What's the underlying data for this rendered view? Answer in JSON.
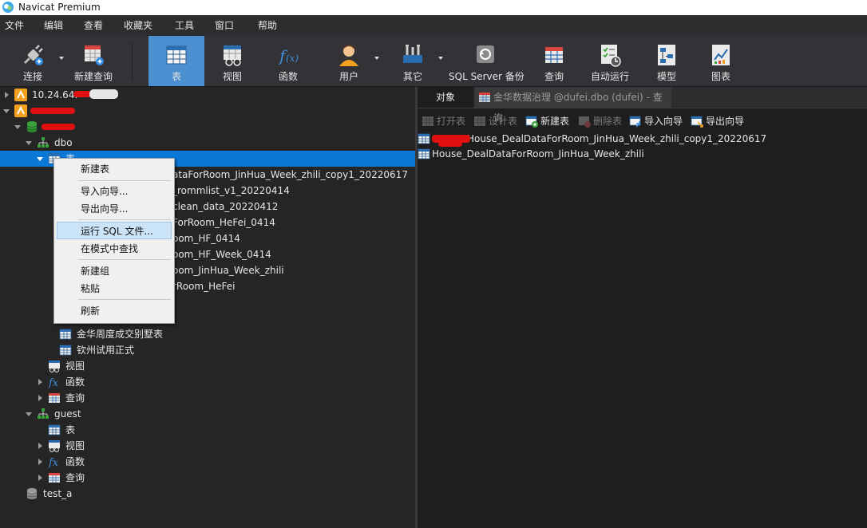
{
  "window": {
    "title": "Navicat Premium"
  },
  "menu": [
    "文件",
    "编辑",
    "查看",
    "收藏夹",
    "工具",
    "窗口",
    "帮助"
  ],
  "toolbar": [
    {
      "id": "connect",
      "label": "连接",
      "icon": "plug-icon"
    },
    {
      "id": "new-query",
      "label": "新建查询",
      "icon": "new-query-icon"
    },
    {
      "id": "table",
      "label": "表",
      "icon": "table-icon",
      "active": true
    },
    {
      "id": "view",
      "label": "视图",
      "icon": "view-icon"
    },
    {
      "id": "function",
      "label": "函数",
      "icon": "function-icon"
    },
    {
      "id": "user",
      "label": "用户",
      "icon": "user-icon"
    },
    {
      "id": "other",
      "label": "其它",
      "icon": "tools-icon"
    },
    {
      "id": "backup",
      "label": "SQL Server 备份",
      "icon": "backup-icon"
    },
    {
      "id": "query",
      "label": "查询",
      "icon": "query-icon"
    },
    {
      "id": "automation",
      "label": "自动运行",
      "icon": "automation-icon"
    },
    {
      "id": "model",
      "label": "模型",
      "icon": "model-icon"
    },
    {
      "id": "chart",
      "label": "图表",
      "icon": "chart-icon"
    }
  ],
  "tree": {
    "connection1": "10.24.64.",
    "schema_dbo": "dbo",
    "tables_node": "表",
    "hidden_tables": [
      "ataForRoom_JinHua_Week_zhili_copy1_20220617",
      "_rommlist_v1_20220414",
      "clean_data_20220412",
      "ForRoom_HeFei_0414",
      "oom_HF_0414",
      "oom_HF_Week_0414",
      "oom_JinHua_Week_zhili",
      "rRoom_HeFei"
    ],
    "tables_tail": [
      "金华周度成交别墅表",
      "钦州试用正式"
    ],
    "dbo_children": [
      "视图",
      "函数",
      "查询"
    ],
    "schema_guest": "guest",
    "guest_children": [
      "表",
      "视图",
      "函数",
      "查询"
    ],
    "db_test": "test_a"
  },
  "context_menu": {
    "items": [
      "新建表",
      "导入向导...",
      "导出向导...",
      "运行 SQL 文件...",
      "在模式中查找",
      "新建组",
      "粘贴",
      "刷新"
    ],
    "hovered": "运行 SQL 文件..."
  },
  "right": {
    "tab_objects": "对象",
    "tab_query": "金华数据治理 @dufei.dbo (dufei) - 查询",
    "actions": [
      {
        "label": "打开表",
        "enabled": false
      },
      {
        "label": "设计表",
        "enabled": false
      },
      {
        "label": "新建表",
        "enabled": true
      },
      {
        "label": "删除表",
        "enabled": false
      },
      {
        "label": "导入向导",
        "enabled": true
      },
      {
        "label": "导出向导",
        "enabled": true
      }
    ],
    "objects": [
      "House_DealDataForRoom_JinHua_Week_zhili_copy1_20220617",
      "House_DealDataForRoom_JinHua_Week_zhili"
    ]
  },
  "colors": {
    "accent": "#0a78d7",
    "toolbar_active": "#4b8fd0",
    "background": "#252526"
  }
}
